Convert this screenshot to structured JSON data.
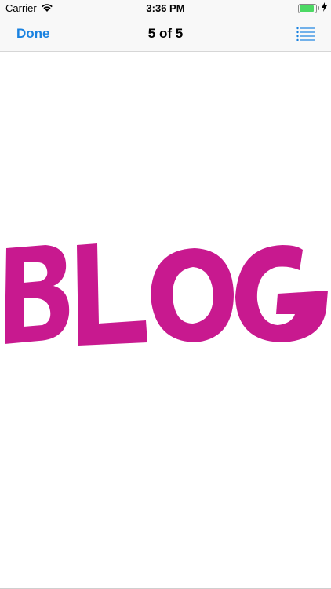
{
  "status_bar": {
    "carrier": "Carrier",
    "time": "3:36 PM",
    "wifi_icon": "wifi-icon",
    "battery_icon": "battery-icon",
    "charging_icon": "bolt-icon",
    "battery_level": 0.8
  },
  "nav": {
    "done_label": "Done",
    "title": "5 of 5",
    "list_icon": "list-icon"
  },
  "content": {
    "image_text": "BLOG",
    "image_color": "#c8198f"
  },
  "colors": {
    "accent": "#1a82e0",
    "bar_background": "#f8f8f8"
  }
}
